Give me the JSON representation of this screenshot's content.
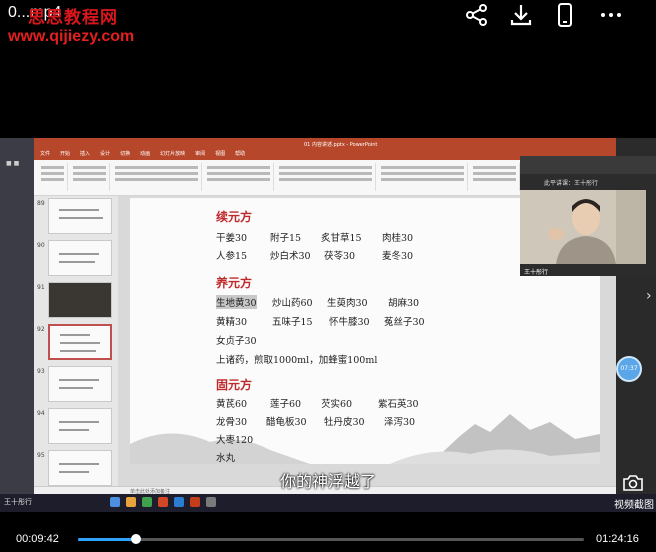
{
  "player": {
    "file_title": "0...mp4",
    "watermark_name": "思思教程网",
    "watermark_url": "www.qijiezy.com",
    "current_time": "00:09:42",
    "duration": "01:24:16",
    "progress": 0.115,
    "subtitle": "你的神浮越了",
    "screenshot_label": "视频截图"
  },
  "ppt": {
    "window_title": "01 内容讲述.pptx - PowerPoint",
    "tabs": [
      "文件",
      "开始",
      "插入",
      "设计",
      "切换",
      "动画",
      "幻灯片放映",
      "审阅",
      "视图",
      "帮助"
    ],
    "status_text": "单击此处添加备注",
    "thumb_numbers": [
      "89",
      "90",
      "91",
      "92",
      "93",
      "94",
      "95"
    ]
  },
  "slide": {
    "sections": [
      {
        "title": "续元方",
        "rows": [
          [
            "干姜30",
            "附子15",
            "炙甘草15",
            "肉桂30"
          ],
          [
            "人参15",
            "炒白术30",
            "茯苓30",
            "麦冬30"
          ]
        ]
      },
      {
        "title": "养元方",
        "rows": [
          [
            "生地黄30",
            "炒山药60",
            "生萸肉30",
            "胡麻30"
          ],
          [
            "黄精30",
            "五味子15",
            "怀牛膝30",
            "菟丝子30"
          ],
          [
            "女贞子30"
          ],
          [
            "上诸药，煎取1000ml，加蜂蜜100ml"
          ]
        ]
      },
      {
        "title": "固元方",
        "rows": [
          [
            "黄芪60",
            "莲子60",
            "芡实60",
            "紫石英30"
          ],
          [
            "龙骨30",
            "醋龟板30",
            "牡丹皮30",
            "泽泻30"
          ],
          [
            "大枣120"
          ],
          [
            "水丸"
          ]
        ]
      }
    ]
  },
  "call": {
    "subtitle": "此平讲课：王十彤行",
    "participant": "王十彤行"
  },
  "badge": "07:37",
  "taskbar": {
    "user": "王十彤行"
  },
  "icons": {
    "share": "share-icon",
    "download": "download-icon",
    "phone": "phone-icon",
    "more": "more-icon",
    "camera": "camera-icon"
  },
  "colors": {
    "accent": "#2ea3ff",
    "ppt_red": "#b7472a",
    "heading": "#c0292b"
  }
}
